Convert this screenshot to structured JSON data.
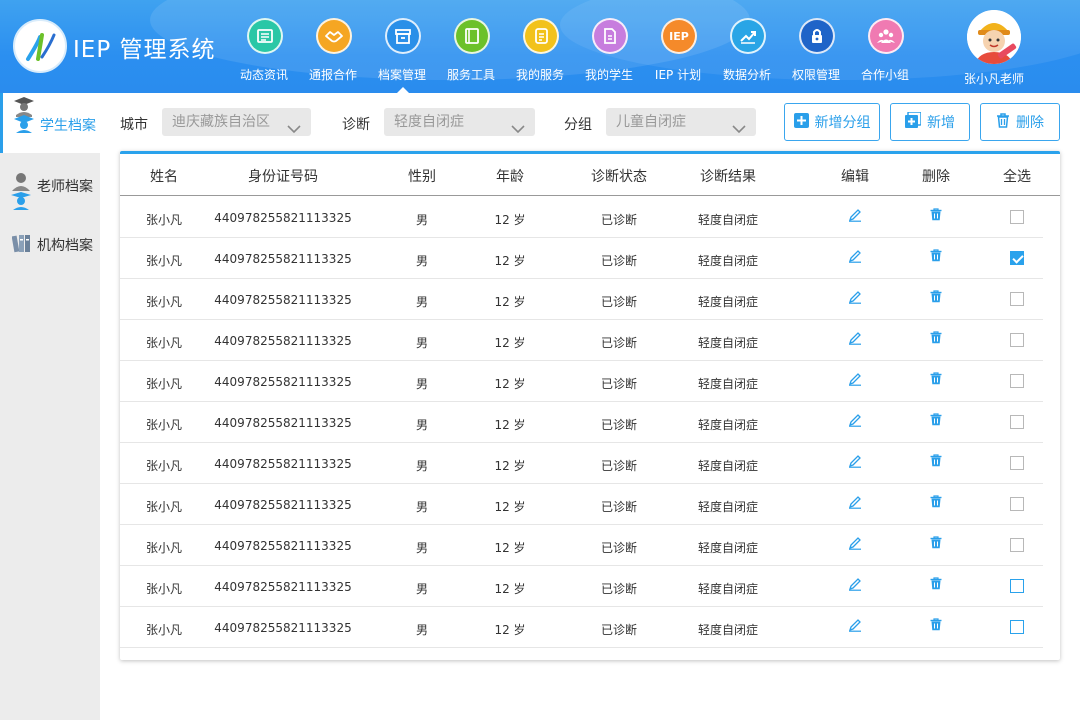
{
  "app": {
    "title": "IEP 管理系统"
  },
  "nav": [
    {
      "label": "动态资讯",
      "icon": "news-icon",
      "color": "#2ac7a6"
    },
    {
      "label": "通报合作",
      "icon": "handshake-icon",
      "color": "#f5a623"
    },
    {
      "label": "档案管理",
      "icon": "archive-box-icon",
      "color": "#2a8fe8",
      "active": true
    },
    {
      "label": "服务工具",
      "icon": "toolbox-icon",
      "color": "#6cc12a"
    },
    {
      "label": "我的服务",
      "icon": "document-icon",
      "color": "#f2c21b"
    },
    {
      "label": "我的学生",
      "icon": "file-icon",
      "color": "#c77dde"
    },
    {
      "label": "IEP 计划",
      "icon": "iep-badge-icon",
      "color": "#f58a2a",
      "badge": "IEP"
    },
    {
      "label": "数据分析",
      "icon": "chart-icon",
      "color": "#29a5e6"
    },
    {
      "label": "权限管理",
      "icon": "lock-icon",
      "color": "#1f64c8"
    },
    {
      "label": "合作小组",
      "icon": "group-icon",
      "color": "#f07ab2"
    }
  ],
  "user": {
    "name": "张小凡老师"
  },
  "sidebar": {
    "items": [
      {
        "label": "学生档案",
        "active": true
      },
      {
        "label": "老师档案"
      },
      {
        "label": "机构档案"
      }
    ]
  },
  "filters": {
    "city_label": "城市",
    "city_value": "迪庆藏族自治区",
    "diagnosis_label": "诊断",
    "diagnosis_value": "轻度自闭症",
    "group_label": "分组",
    "group_value": "儿童自闭症"
  },
  "actions": {
    "add_group": "新增分组",
    "add": "新增",
    "delete": "删除"
  },
  "table": {
    "headers": [
      "姓名",
      "身份证号码",
      "性别",
      "年龄",
      "诊断状态",
      "诊断结果",
      "编辑",
      "删除",
      "全选"
    ],
    "rows": [
      {
        "name": "张小凡",
        "id": "440978255821113325",
        "gender": "男",
        "age": "12 岁",
        "status": "已诊断",
        "result": "轻度自闭症",
        "checked": false,
        "cb_style": "grey"
      },
      {
        "name": "张小凡",
        "id": "440978255821113325",
        "gender": "男",
        "age": "12 岁",
        "status": "已诊断",
        "result": "轻度自闭症",
        "checked": true,
        "cb_style": "blue"
      },
      {
        "name": "张小凡",
        "id": "440978255821113325",
        "gender": "男",
        "age": "12 岁",
        "status": "已诊断",
        "result": "轻度自闭症",
        "checked": false,
        "cb_style": "grey"
      },
      {
        "name": "张小凡",
        "id": "440978255821113325",
        "gender": "男",
        "age": "12 岁",
        "status": "已诊断",
        "result": "轻度自闭症",
        "checked": false,
        "cb_style": "grey"
      },
      {
        "name": "张小凡",
        "id": "440978255821113325",
        "gender": "男",
        "age": "12 岁",
        "status": "已诊断",
        "result": "轻度自闭症",
        "checked": false,
        "cb_style": "grey"
      },
      {
        "name": "张小凡",
        "id": "440978255821113325",
        "gender": "男",
        "age": "12 岁",
        "status": "已诊断",
        "result": "轻度自闭症",
        "checked": false,
        "cb_style": "grey"
      },
      {
        "name": "张小凡",
        "id": "440978255821113325",
        "gender": "男",
        "age": "12 岁",
        "status": "已诊断",
        "result": "轻度自闭症",
        "checked": false,
        "cb_style": "grey"
      },
      {
        "name": "张小凡",
        "id": "440978255821113325",
        "gender": "男",
        "age": "12 岁",
        "status": "已诊断",
        "result": "轻度自闭症",
        "checked": false,
        "cb_style": "grey"
      },
      {
        "name": "张小凡",
        "id": "440978255821113325",
        "gender": "男",
        "age": "12 岁",
        "status": "已诊断",
        "result": "轻度自闭症",
        "checked": false,
        "cb_style": "grey"
      },
      {
        "name": "张小凡",
        "id": "440978255821113325",
        "gender": "男",
        "age": "12 岁",
        "status": "已诊断",
        "result": "轻度自闭症",
        "checked": false,
        "cb_style": "blue"
      },
      {
        "name": "张小凡",
        "id": "440978255821113325",
        "gender": "男",
        "age": "12 岁",
        "status": "已诊断",
        "result": "轻度自闭症",
        "checked": false,
        "cb_style": "blue"
      }
    ]
  },
  "colors": {
    "accent": "#2aa2ec",
    "header": "#2b8ff0",
    "sidebar_bg": "#ececec"
  }
}
